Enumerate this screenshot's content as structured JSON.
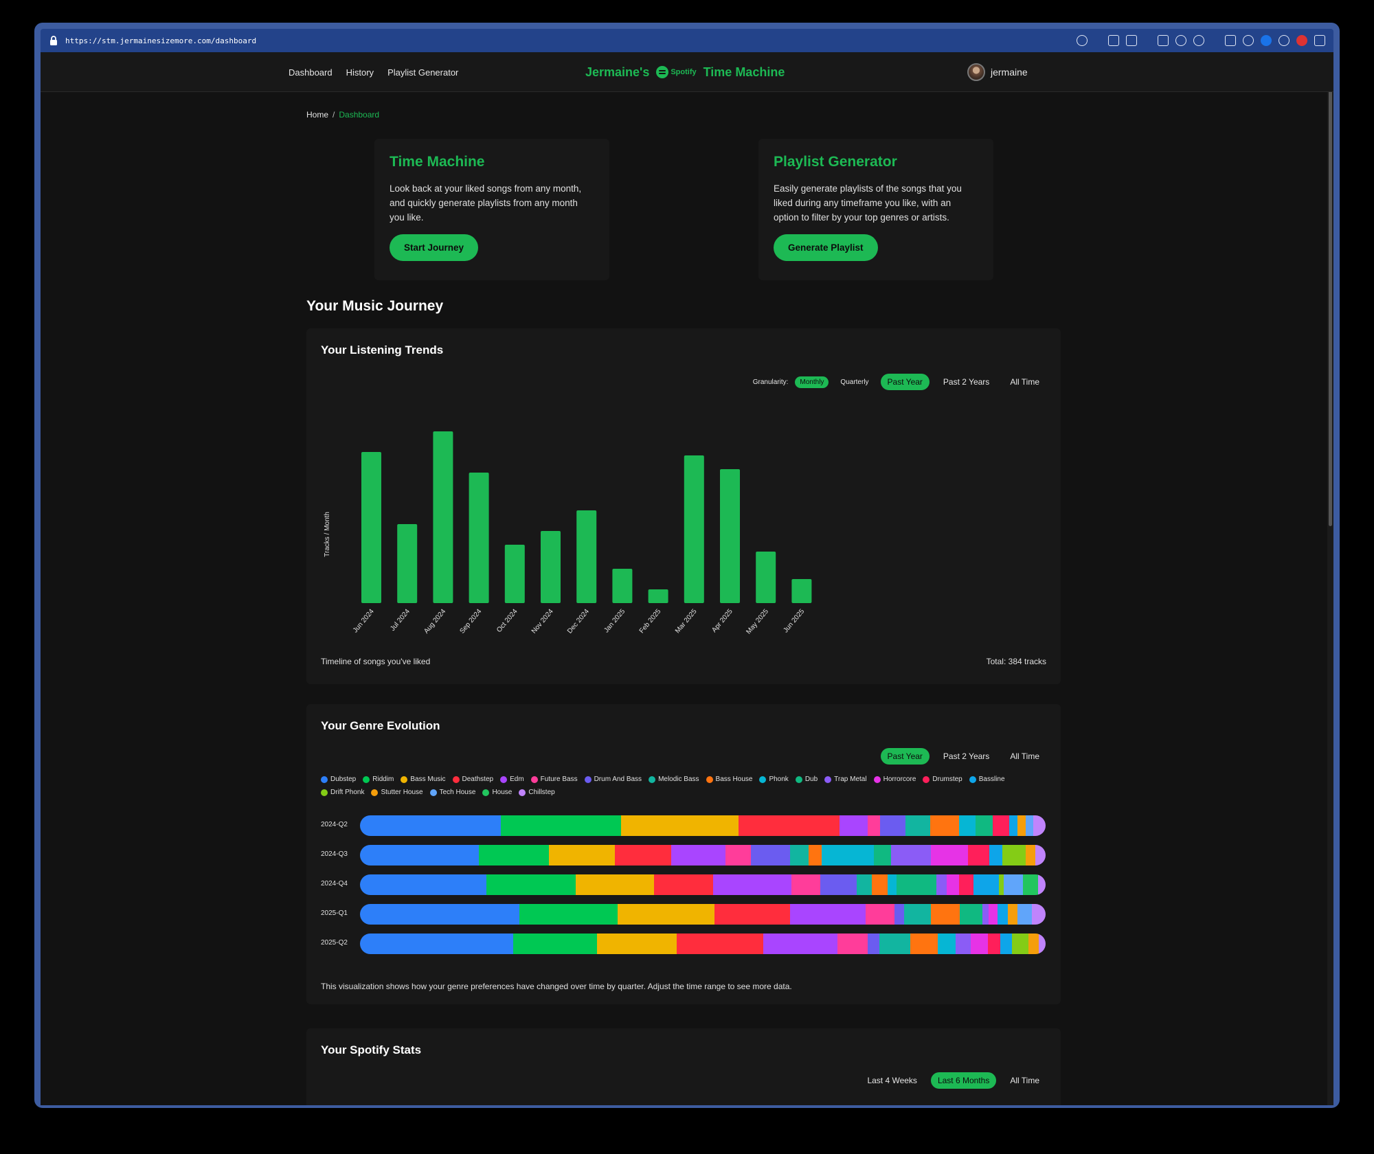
{
  "browser": {
    "url": "https://stm.jermainesizemore.com/dashboard"
  },
  "nav": {
    "links": [
      "Dashboard",
      "History",
      "Playlist Generator"
    ],
    "brand_left": "Jermaine's",
    "spotify_word": "Spotify",
    "brand_right": "Time Machine",
    "username": "jermaine"
  },
  "breadcrumb": {
    "home": "Home",
    "sep": "/",
    "current": "Dashboard"
  },
  "features": [
    {
      "title": "Time Machine",
      "text": "Look back at your liked songs from any month, and quickly generate playlists from any month you like.",
      "button": "Start Journey"
    },
    {
      "title": "Playlist Generator",
      "text": "Easily generate playlists of the songs that you liked during any timeframe you like, with an option to filter by your top genres or artists.",
      "button": "Generate Playlist"
    }
  ],
  "journey_title": "Your Music Journey",
  "trends": {
    "title": "Your Listening Trends",
    "granularity_label": "Granularity:",
    "granularity": [
      "Monthly",
      "Quarterly"
    ],
    "ranges": [
      "Past Year",
      "Past 2 Years",
      "All Time"
    ],
    "footer_left": "Timeline of songs you've liked",
    "footer_right": "Total: 384 tracks"
  },
  "chart_data": {
    "type": "bar",
    "ylabel": "Tracks / Month",
    "categories": [
      "Jun 2024",
      "Jul 2024",
      "Aug 2024",
      "Sep 2024",
      "Oct 2024",
      "Nov 2024",
      "Dec 2024",
      "Jan 2025",
      "Feb 2025",
      "Mar 2025",
      "Apr 2025",
      "May 2025",
      "Jun 2025"
    ],
    "values": [
      44,
      23,
      50,
      38,
      17,
      21,
      27,
      10,
      4,
      43,
      39,
      15,
      7
    ],
    "ylim": [
      0,
      52
    ],
    "color": "#1db954"
  },
  "genre": {
    "title": "Your Genre Evolution",
    "ranges": [
      "Past Year",
      "Past 2 Years",
      "All Time"
    ],
    "legend": [
      {
        "name": "Dubstep",
        "color": "#2d7ff9"
      },
      {
        "name": "Riddim",
        "color": "#00c853"
      },
      {
        "name": "Bass Music",
        "color": "#f0b400"
      },
      {
        "name": "Deathstep",
        "color": "#ff2d3d"
      },
      {
        "name": "Edm",
        "color": "#a945ff"
      },
      {
        "name": "Future Bass",
        "color": "#ff3d9a"
      },
      {
        "name": "Drum And Bass",
        "color": "#6b5cf0"
      },
      {
        "name": "Melodic Bass",
        "color": "#12b5a0"
      },
      {
        "name": "Bass House",
        "color": "#ff7410"
      },
      {
        "name": "Phonk",
        "color": "#06b6d4"
      },
      {
        "name": "Dub",
        "color": "#10b981"
      },
      {
        "name": "Trap Metal",
        "color": "#8b5cf6"
      },
      {
        "name": "Horrorcore",
        "color": "#e633e6"
      },
      {
        "name": "Drumstep",
        "color": "#ff1f5a"
      },
      {
        "name": "Bassline",
        "color": "#0ea5e9"
      },
      {
        "name": "Drift Phonk",
        "color": "#84cc16"
      },
      {
        "name": "Stutter House",
        "color": "#f59e0b"
      },
      {
        "name": "Tech House",
        "color": "#60a5fa"
      },
      {
        "name": "House",
        "color": "#22c55e"
      },
      {
        "name": "Chillstep",
        "color": "#c084fc"
      }
    ],
    "quarters": [
      {
        "label": "2024-Q2",
        "shares": [
          21,
          18,
          17.5,
          15,
          4.3,
          1.8,
          3.8,
          3.7,
          4.3,
          2.5,
          2.5,
          0,
          0,
          2.5,
          1.2,
          0,
          1.2,
          1.2,
          0,
          1.8
        ]
      },
      {
        "label": "2024-Q3",
        "shares": [
          17.4,
          10.3,
          9.6,
          8.3,
          7.9,
          3.7,
          5.8,
          2.7,
          1.9,
          7.7,
          2.5,
          5.8,
          5.4,
          3.2,
          1.9,
          3.4,
          1.4,
          0,
          0,
          1.5
        ]
      },
      {
        "label": "2024-Q4",
        "shares": [
          18.5,
          13.2,
          11.4,
          8.7,
          11.5,
          4.2,
          5.4,
          2.2,
          2.3,
          1.3,
          5.9,
          1.5,
          1.8,
          2.1,
          3.8,
          0.7,
          0,
          2.8,
          2.2,
          1.1
        ]
      },
      {
        "label": "2025-Q1",
        "shares": [
          23.2,
          14.3,
          14.2,
          11,
          11,
          4.2,
          1.4,
          3.9,
          4.2,
          0,
          3.3,
          0.9,
          1.3,
          0,
          1.5,
          0,
          1.4,
          2.1,
          0,
          2
        ]
      },
      {
        "label": "2025-Q2",
        "shares": [
          22,
          12,
          11.5,
          12.4,
          10.6,
          4.4,
          1.6,
          4.5,
          3.9,
          2.6,
          0,
          2.2,
          2.4,
          1.8,
          1.7,
          2.3,
          1.5,
          0,
          0,
          1
        ]
      }
    ],
    "note": "This visualization shows how your genre preferences have changed over time by quarter. Adjust the time range to see more data."
  },
  "stats": {
    "title": "Your Spotify Stats",
    "ranges": [
      "Last 4 Weeks",
      "Last 6 Months",
      "All Time"
    ]
  }
}
